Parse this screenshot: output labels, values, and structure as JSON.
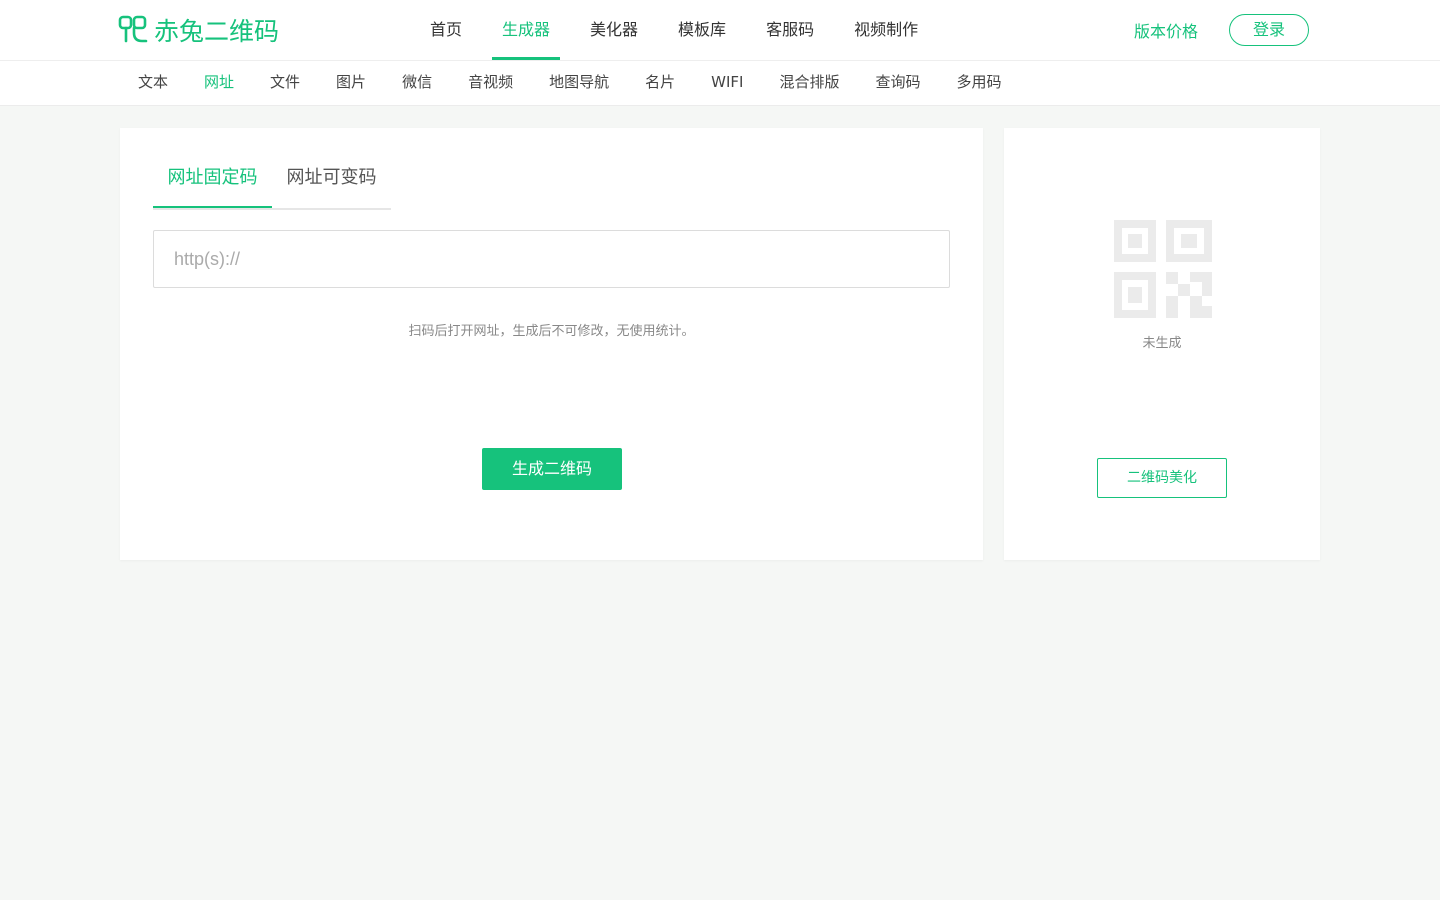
{
  "brand": {
    "name": "赤兔二维码",
    "accent_color": "#16c27c",
    "logo_icon": "qr-rabbit-logo-icon"
  },
  "main_nav": {
    "items": [
      {
        "label": "首页",
        "active": false
      },
      {
        "label": "生成器",
        "active": true
      },
      {
        "label": "美化器",
        "active": false
      },
      {
        "label": "模板库",
        "active": false
      },
      {
        "label": "客服码",
        "active": false
      },
      {
        "label": "视频制作",
        "active": false
      }
    ],
    "pricing_label": "版本价格",
    "login_label": "登录"
  },
  "sub_nav": {
    "items": [
      {
        "label": "文本",
        "active": false
      },
      {
        "label": "网址",
        "active": true
      },
      {
        "label": "文件",
        "active": false
      },
      {
        "label": "图片",
        "active": false
      },
      {
        "label": "微信",
        "active": false
      },
      {
        "label": "音视频",
        "active": false
      },
      {
        "label": "地图导航",
        "active": false
      },
      {
        "label": "名片",
        "active": false
      },
      {
        "label": "WIFI",
        "active": false
      },
      {
        "label": "混合排版",
        "active": false
      },
      {
        "label": "查询码",
        "active": false
      },
      {
        "label": "多用码",
        "active": false
      }
    ]
  },
  "generator": {
    "tabs": [
      {
        "label": "网址固定码",
        "active": true
      },
      {
        "label": "网址可变码",
        "active": false
      }
    ],
    "url_input": {
      "value": "",
      "placeholder": "http(s)://"
    },
    "hint": "扫码后打开网址，生成后不可修改，无使用统计。",
    "generate_label": "生成二维码"
  },
  "preview": {
    "icon": "qr-placeholder-icon",
    "status": "未生成",
    "beautify_label": "二维码美化"
  }
}
